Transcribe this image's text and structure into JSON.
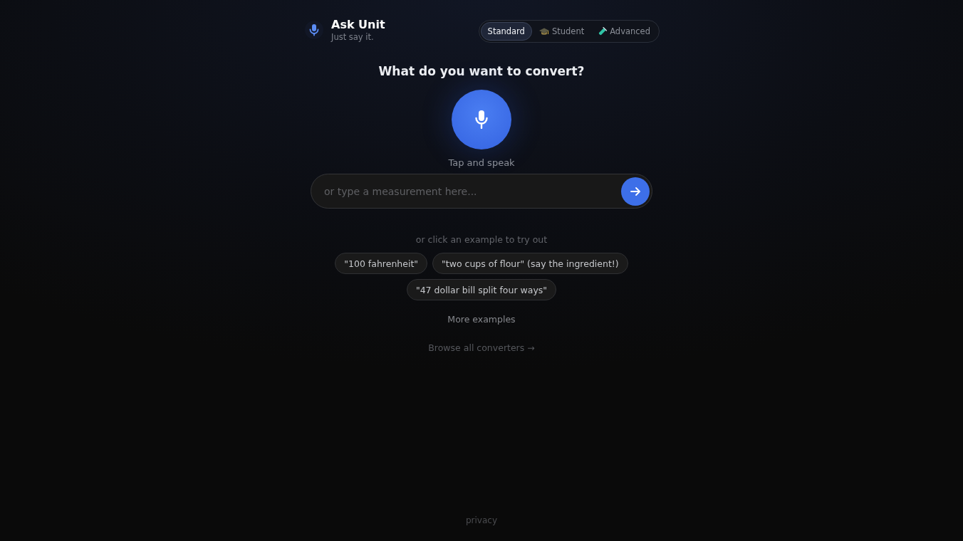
{
  "header": {
    "title": "Ask Unit",
    "tagline": "Just say it."
  },
  "modes": [
    {
      "label": "Standard",
      "selected": true,
      "kind": "plain"
    },
    {
      "label": "Student",
      "selected": false,
      "kind": "student"
    },
    {
      "label": "Advanced",
      "selected": false,
      "kind": "advanced"
    }
  ],
  "prompt": "What do you want to convert?",
  "voice": {
    "hint": "Tap and speak"
  },
  "search": {
    "placeholder": "or type a measurement here..."
  },
  "examples": {
    "intro": "or click an example to try out",
    "items": [
      "\"100 fahrenheit\"",
      "\"two cups of flour\" (say the ingredient!)",
      "\"47 dollar bill split four ways\""
    ],
    "more": "More examples"
  },
  "browse_link": "Browse all converters →",
  "footer": {
    "privacy": "privacy"
  }
}
